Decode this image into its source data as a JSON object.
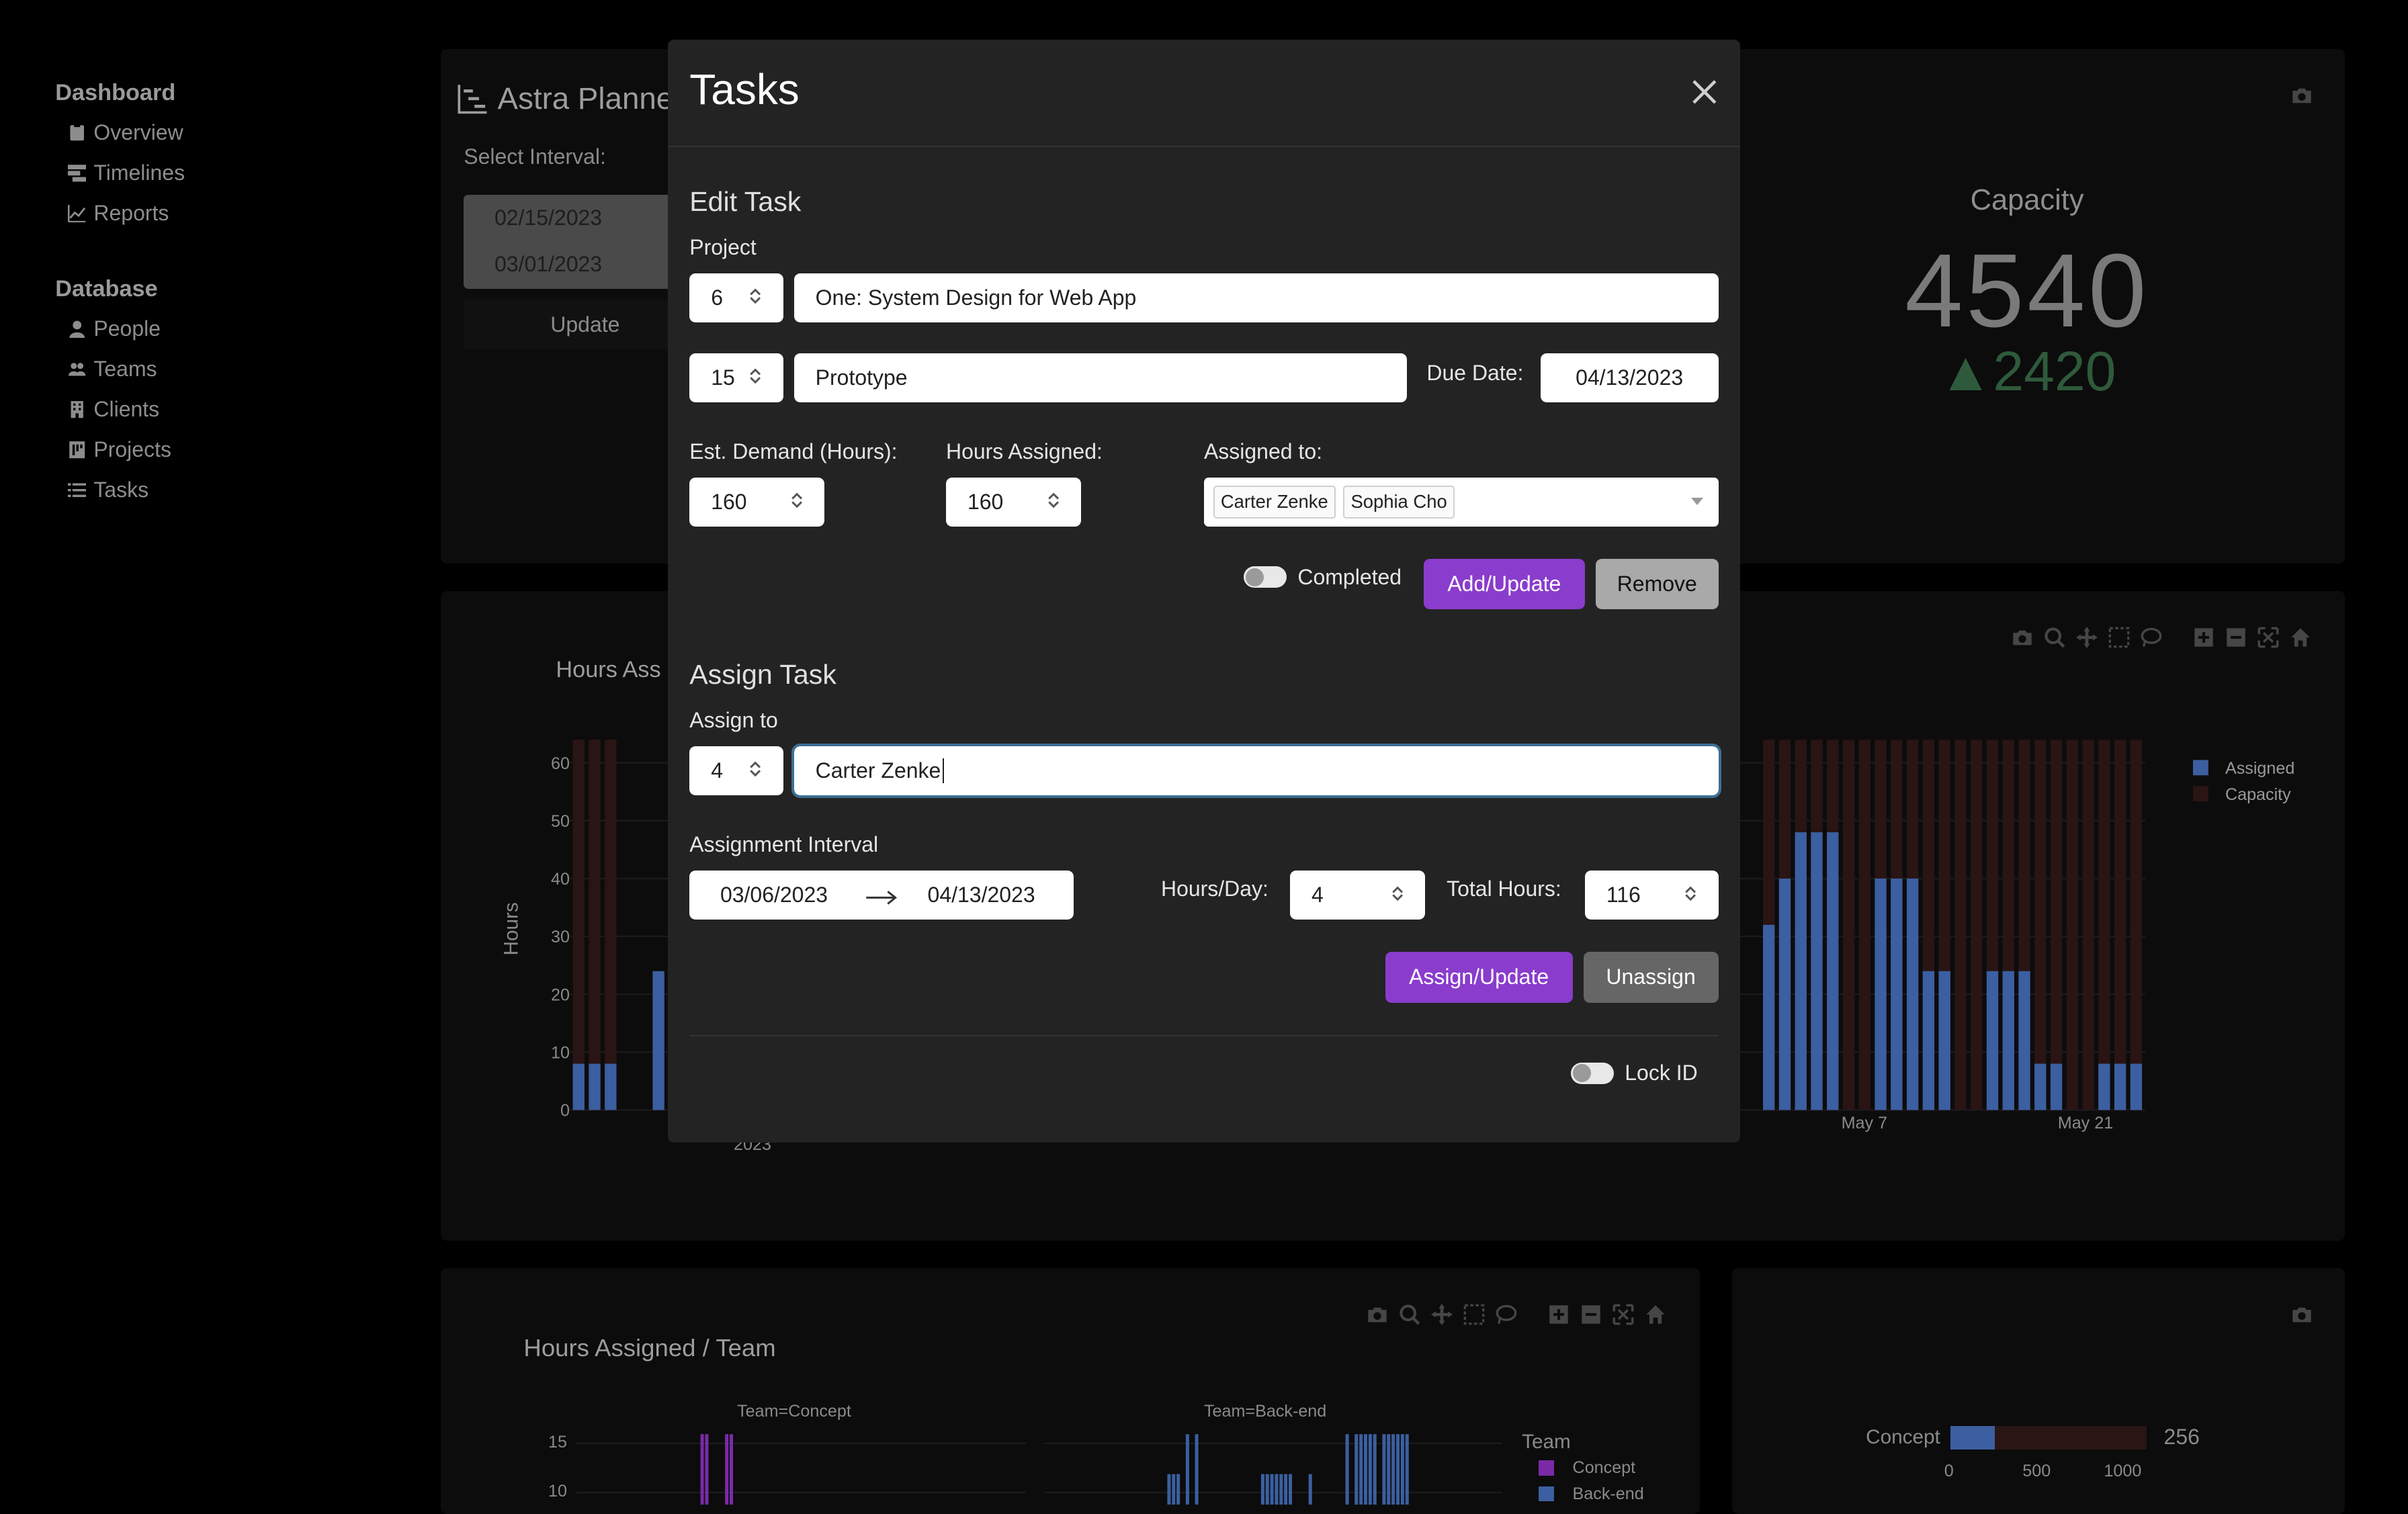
{
  "sidebar": {
    "dashboard_heading": "Dashboard",
    "dashboard_items": [
      {
        "label": "Overview",
        "icon": "clipboard-icon"
      },
      {
        "label": "Timelines",
        "icon": "timeline-icon"
      },
      {
        "label": "Reports",
        "icon": "chart-line-icon"
      }
    ],
    "database_heading": "Database",
    "database_items": [
      {
        "label": "People",
        "icon": "user-icon"
      },
      {
        "label": "Teams",
        "icon": "users-icon"
      },
      {
        "label": "Clients",
        "icon": "building-icon"
      },
      {
        "label": "Projects",
        "icon": "project-icon"
      },
      {
        "label": "Tasks",
        "icon": "list-icon"
      }
    ]
  },
  "background": {
    "app_title": "Astra Planne",
    "select_interval_label": "Select Interval:",
    "interval_start": "02/15/2023",
    "interval_end": "03/01/2023",
    "update_label": "Update",
    "capacity_title": "Capacity",
    "capacity_value": "4540",
    "capacity_delta": "▲2420",
    "hours_chart_title": "Hours Ass",
    "team_chart_title": "Hours Assigned / Team",
    "team_concept_facet": "Team=Concept",
    "team_backend_facet": "Team=Back-end",
    "team_legend_title": "Team",
    "team_legend": [
      "Concept",
      "Back-end"
    ],
    "team_yticks": [
      "15",
      "10"
    ],
    "bar_label": "Concept",
    "bar_value": "256",
    "bar_xticks": [
      "0",
      "500",
      "1000"
    ]
  },
  "chart_data": {
    "type": "bar",
    "ylabel": "Hours",
    "ylim": [
      0,
      65
    ],
    "yticks": [
      "0",
      "10",
      "20",
      "30",
      "40",
      "50",
      "60"
    ],
    "xticks_visible": [
      "2023",
      "May 7",
      "May 21"
    ],
    "series": [
      {
        "name": "Assigned",
        "color": "#3b5fa0"
      },
      {
        "name": "Capacity",
        "color": "#2a1414"
      }
    ],
    "left_values": [
      8,
      8,
      8,
      0,
      0,
      24
    ],
    "right_values": [
      32,
      40,
      48,
      48,
      48,
      0,
      0,
      40,
      40,
      40,
      24,
      24,
      0,
      0,
      24,
      24,
      24,
      8,
      8,
      0,
      0,
      8,
      8,
      8
    ],
    "capacity_value": 64
  },
  "modal": {
    "title": "Tasks",
    "edit_task": {
      "heading": "Edit Task",
      "project_label": "Project",
      "project_id": "6",
      "project_name": "One: System Design for Web App",
      "task_id": "15",
      "task_name": "Prototype",
      "due_date_label": "Due Date:",
      "due_date": "04/13/2023",
      "est_demand_label": "Est. Demand (Hours):",
      "est_demand": "160",
      "hours_assigned_label": "Hours Assigned:",
      "hours_assigned": "160",
      "assigned_to_label": "Assigned to:",
      "assigned_to": [
        "Carter Zenke",
        "Sophia Cho"
      ],
      "completed_label": "Completed",
      "add_update_label": "Add/Update",
      "remove_label": "Remove"
    },
    "assign_task": {
      "heading": "Assign Task",
      "assign_to_label": "Assign to",
      "person_id": "4",
      "person_name": "Carter Zenke",
      "interval_label": "Assignment Interval",
      "interval_start": "03/06/2023",
      "interval_end": "04/13/2023",
      "hours_per_day_label": "Hours/Day:",
      "hours_per_day": "4",
      "total_hours_label": "Total Hours:",
      "total_hours": "116",
      "assign_update_label": "Assign/Update",
      "unassign_label": "Unassign"
    },
    "lock_id_label": "Lock ID"
  }
}
